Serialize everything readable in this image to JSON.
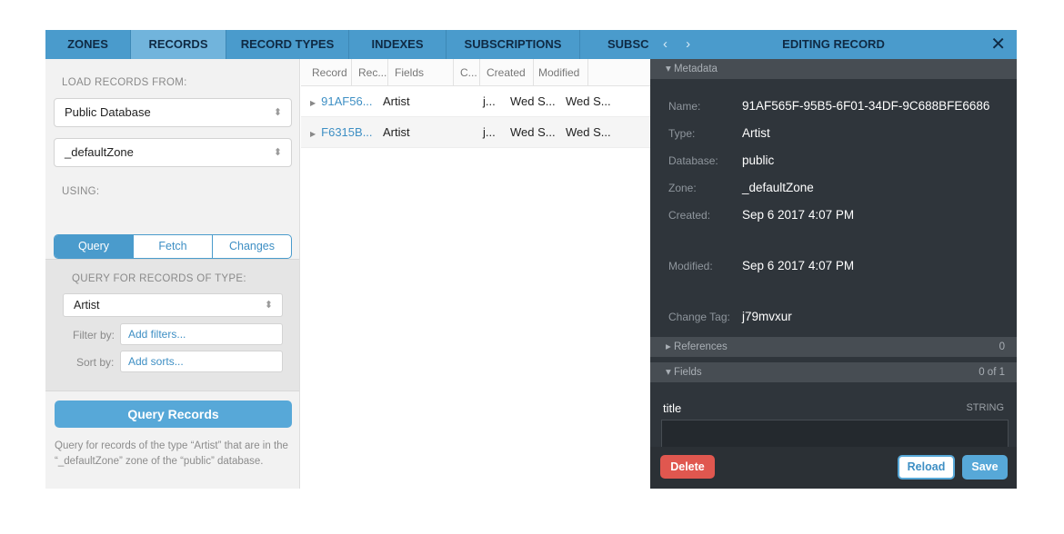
{
  "tabs": [
    {
      "label": "ZONES"
    },
    {
      "label": "RECORDS"
    },
    {
      "label": "RECORD TYPES"
    },
    {
      "label": "INDEXES"
    },
    {
      "label": "SUBSCRIPTIONS"
    },
    {
      "label": "SUBSC"
    }
  ],
  "left": {
    "load_label": "LOAD RECORDS FROM:",
    "database_select": "Public Database",
    "zone_select": "_defaultZone",
    "using_label": "USING:",
    "segments": [
      "Query",
      "Fetch",
      "Changes"
    ],
    "query_type_label": "QUERY FOR RECORDS OF TYPE:",
    "type_select": "Artist",
    "filter_label": "Filter by:",
    "filter_placeholder": "Add filters...",
    "sort_label": "Sort by:",
    "sort_placeholder": "Add sorts...",
    "query_button": "Query Records",
    "help_text": "Query for records of the type “Artist” that are in the “_defaultZone” zone of the “public” database."
  },
  "table": {
    "columns": [
      "Record ...",
      "Rec...",
      "Fields",
      "C...",
      "Created",
      "Modified"
    ],
    "rows": [
      {
        "record": "91AF56...",
        "type": "Artist",
        "fields": "",
        "c": "j...",
        "created": "Wed S...",
        "modified": "Wed S..."
      },
      {
        "record": "F6315B...",
        "type": "Artist",
        "fields": "",
        "c": "j...",
        "created": "Wed S...",
        "modified": "Wed S..."
      }
    ]
  },
  "editor": {
    "title": "EDITING RECORD",
    "close": "✕",
    "nav": "‹ ›",
    "metadata_label": "▾ Metadata",
    "meta": {
      "name_key": "Name:",
      "name_val": "91AF565F-95B5-6F01-34DF-9C688BFE6686",
      "type_key": "Type:",
      "type_val": "Artist",
      "db_key": "Database:",
      "db_val": "public",
      "zone_key": "Zone:",
      "zone_val": "_defaultZone",
      "created_key": "Created:",
      "created_val": "Sep 6 2017 4:07 PM",
      "modified_key": "Modified:",
      "modified_val": "Sep 6 2017 4:07 PM",
      "tag_key": "Change Tag:",
      "tag_val": "j79mvxur"
    },
    "references_label": "▸ References",
    "references_count": "0",
    "fields_label": "▾ Fields",
    "fields_count": "0 of 1",
    "field_name": "title",
    "field_type": "STRING",
    "delete_label": "Delete",
    "reload_label": "Reload",
    "save_label": "Save"
  }
}
